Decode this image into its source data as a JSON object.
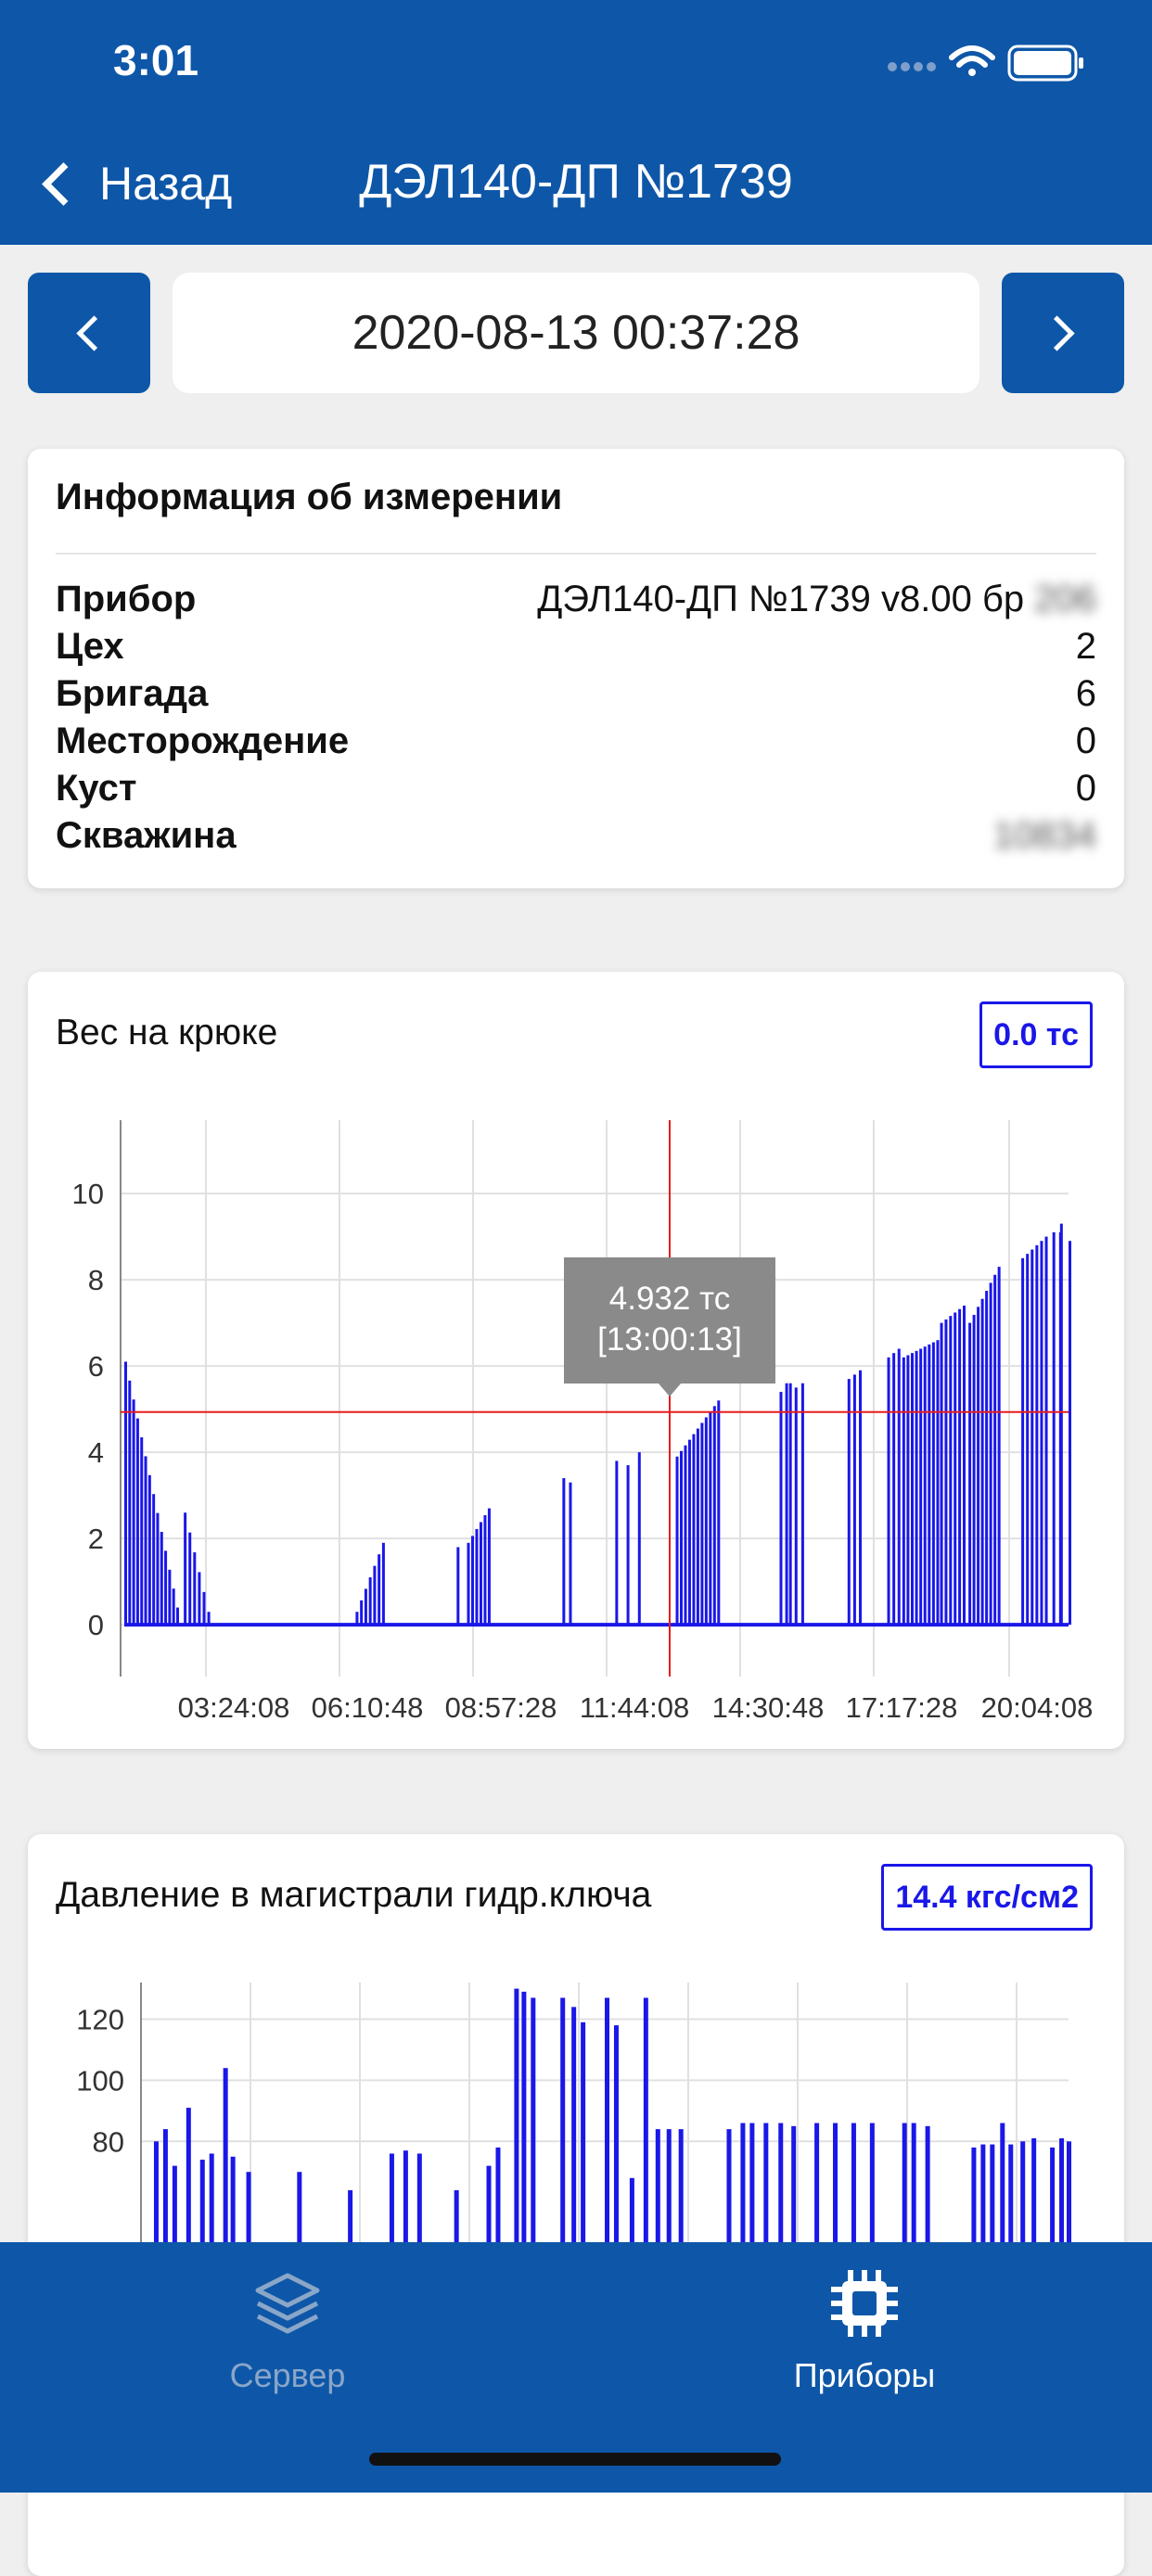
{
  "status_bar": {
    "time": "3:01"
  },
  "nav": {
    "back_label": "Назад",
    "title": "ДЭЛ140-ДП №1739"
  },
  "date_picker": {
    "value": "2020-08-13 00:37:28"
  },
  "info": {
    "title": "Информация об измерении",
    "rows": [
      {
        "label": "Прибор",
        "value": "ДЭЛ140-ДП №1739 v8.00 бр",
        "hidden": "206"
      },
      {
        "label": "Цех",
        "value": "2"
      },
      {
        "label": "Бригада",
        "value": "6"
      },
      {
        "label": "Месторождение",
        "value": "0"
      },
      {
        "label": "Куст",
        "value": "0"
      },
      {
        "label": "Скважина",
        "value": "",
        "hidden": "10834"
      }
    ]
  },
  "hook_chart": {
    "title": "Вес на крюке",
    "badge": "0.0 тс",
    "tooltip_value": "4.932 тс",
    "tooltip_time": "[13:00:13]"
  },
  "pressure_chart": {
    "title": "Давление в магистрали гидр.ключа",
    "badge": "14.4 кгс/см2"
  },
  "tabbar": {
    "server_label": "Сервер",
    "devices_label": "Приборы"
  },
  "colors": {
    "brand": "#0e57a8",
    "series": "#1a17e8",
    "crosshair": "#e81c1c"
  },
  "chart_data": [
    {
      "type": "bar",
      "title": "Вес на крюке",
      "x_tick_labels": [
        "03:24:08",
        "06:10:48",
        "08:57:28",
        "11:44:08",
        "14:30:48",
        "17:17:28",
        "20:04:08"
      ],
      "y_ticks": [
        0,
        2,
        4,
        6,
        8,
        10
      ],
      "ylim": [
        -1.2,
        11.7
      ],
      "crosshair": {
        "time": "13:00:13",
        "value": 4.932
      },
      "groups": [
        {
          "start": 0.0,
          "end": 0.055,
          "from": 6.1,
          "to": 0.4
        },
        {
          "start": 0.063,
          "end": 0.088,
          "from": 2.6,
          "to": 0.3
        },
        {
          "start": 0.245,
          "end": 0.273,
          "from": 0.3,
          "to": 1.9
        },
        {
          "start": 0.352,
          "end": 0.357,
          "from": 1.8,
          "to": 1.8
        },
        {
          "start": 0.363,
          "end": 0.385,
          "from": 1.9,
          "to": 2.7
        },
        {
          "start": 0.464,
          "end": 0.471,
          "from": 3.4,
          "to": 3.3
        },
        {
          "start": 0.52,
          "end": 0.523,
          "from": 3.8,
          "to": 3.8
        },
        {
          "start": 0.532,
          "end": 0.536,
          "from": 3.7,
          "to": 3.7
        },
        {
          "start": 0.544,
          "end": 0.548,
          "from": 4.0,
          "to": 4.0
        },
        {
          "start": 0.584,
          "end": 0.628,
          "from": 3.9,
          "to": 5.2
        },
        {
          "start": 0.694,
          "end": 0.7,
          "from": 5.4,
          "to": 5.6
        },
        {
          "start": 0.704,
          "end": 0.71,
          "from": 5.6,
          "to": 5.5
        },
        {
          "start": 0.717,
          "end": 0.722,
          "from": 5.6,
          "to": 5.6
        },
        {
          "start": 0.766,
          "end": 0.778,
          "from": 5.7,
          "to": 5.9
        },
        {
          "start": 0.808,
          "end": 0.819,
          "from": 6.2,
          "to": 6.4
        },
        {
          "start": 0.824,
          "end": 0.86,
          "from": 6.2,
          "to": 6.6
        },
        {
          "start": 0.864,
          "end": 0.888,
          "from": 7.0,
          "to": 7.4
        },
        {
          "start": 0.894,
          "end": 0.925,
          "from": 7.0,
          "to": 8.3
        },
        {
          "start": 0.95,
          "end": 0.975,
          "from": 8.5,
          "to": 9.0
        },
        {
          "start": 0.983,
          "end": 0.99,
          "from": 9.1,
          "to": 9.1
        },
        {
          "start": 0.991,
          "end": 1.0,
          "from": 9.3,
          "to": 8.9
        }
      ]
    },
    {
      "type": "bar",
      "title": "Давление в магистрали гидр.ключа",
      "y_ticks": [
        80,
        100,
        120
      ],
      "ylim": [
        47,
        132
      ],
      "bars": [
        [
          0.01,
          80
        ],
        [
          0.02,
          84
        ],
        [
          0.03,
          72
        ],
        [
          0.045,
          91
        ],
        [
          0.06,
          74
        ],
        [
          0.07,
          76
        ],
        [
          0.085,
          104
        ],
        [
          0.093,
          75
        ],
        [
          0.11,
          70
        ],
        [
          0.165,
          70
        ],
        [
          0.22,
          64
        ],
        [
          0.265,
          76
        ],
        [
          0.28,
          77
        ],
        [
          0.295,
          76
        ],
        [
          0.335,
          64
        ],
        [
          0.37,
          72
        ],
        [
          0.38,
          78
        ],
        [
          0.4,
          130
        ],
        [
          0.408,
          129
        ],
        [
          0.418,
          127
        ],
        [
          0.45,
          127
        ],
        [
          0.462,
          124
        ],
        [
          0.472,
          119
        ],
        [
          0.498,
          127
        ],
        [
          0.508,
          118
        ],
        [
          0.525,
          68
        ],
        [
          0.54,
          127
        ],
        [
          0.553,
          84
        ],
        [
          0.565,
          84
        ],
        [
          0.578,
          84
        ],
        [
          0.63,
          84
        ],
        [
          0.645,
          86
        ],
        [
          0.655,
          86
        ],
        [
          0.67,
          86
        ],
        [
          0.686,
          86
        ],
        [
          0.7,
          85
        ],
        [
          0.725,
          86
        ],
        [
          0.745,
          86
        ],
        [
          0.765,
          86
        ],
        [
          0.785,
          86
        ],
        [
          0.82,
          86
        ],
        [
          0.83,
          86
        ],
        [
          0.845,
          85
        ],
        [
          0.895,
          78
        ],
        [
          0.905,
          79
        ],
        [
          0.915,
          79
        ],
        [
          0.926,
          86
        ],
        [
          0.935,
          79
        ],
        [
          0.948,
          80
        ],
        [
          0.96,
          81
        ],
        [
          0.98,
          78
        ],
        [
          0.99,
          81
        ],
        [
          0.998,
          80
        ]
      ]
    }
  ]
}
